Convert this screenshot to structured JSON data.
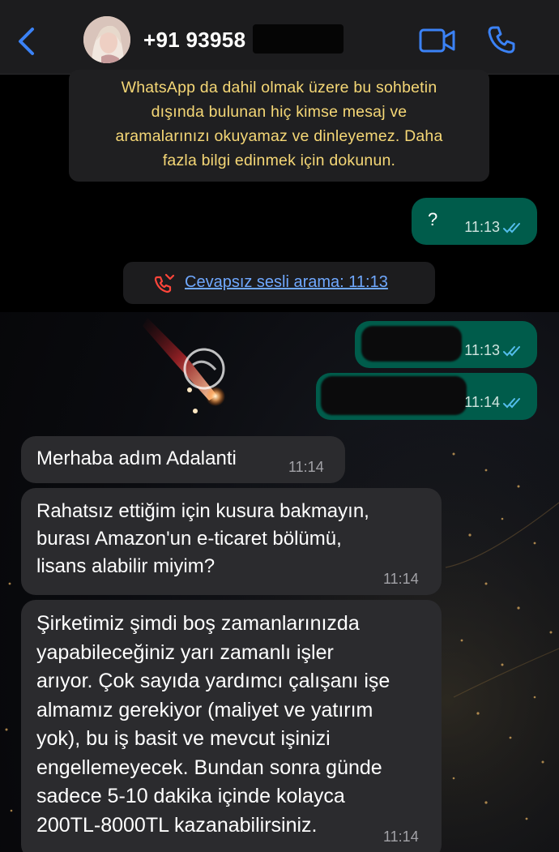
{
  "header": {
    "contact_name": "+91 93958",
    "back_icon": "chevron-left-icon",
    "video_icon": "video-camera-icon",
    "call_icon": "phone-icon",
    "accent_color": "#3b82f6"
  },
  "notice": {
    "lines": [
      "WhatsApp da dahil olmak üzere bu sohbetin",
      "dışında bulunan hiç kimse mesaj ve",
      "aramalarınızı okuyamaz ve dinleyemez. Daha",
      "fazla bilgi edinmek için dokunun."
    ]
  },
  "messages": {
    "out1": {
      "text": "?",
      "time": "11:13"
    },
    "missed_call": {
      "text": "Cevapsız sesli arama: 11:13",
      "icon": "missed-call-icon"
    },
    "out2": {
      "time": "11:13"
    },
    "out3": {
      "time": "11:14"
    },
    "in1": {
      "text": "Merhaba adım Adalanti",
      "time": "11:14"
    },
    "in2": {
      "lines": [
        "Rahatsız ettiğim için kusura bakmayın,",
        "burası Amazon'un e-ticaret bölümü,",
        "lisans alabilir miyim?"
      ],
      "time": "11:14"
    },
    "in3": {
      "lines": [
        "Şirketimiz şimdi boş zamanlarınızda",
        "yapabileceğiniz yarı zamanlı işler",
        "arıyor. Çok sayıda yardımcı çalışanı işe",
        "almamız gerekiyor (maliyet ve yatırım",
        "yok), bu iş basit ve mevcut işinizi",
        "engellemeyecek. Bundan sonra günde",
        "sadece 5-10 dakika içinde kolayca",
        "200TL-8000TL kazanabilirsiniz."
      ],
      "time": "11:14"
    }
  },
  "colors": {
    "outgoing_bubble": "#005c4b",
    "incoming_bubble": "#2b2b2e",
    "notice_text": "#f5d776",
    "link": "#6fa8ff",
    "read_ticks": "#53bdeb"
  }
}
